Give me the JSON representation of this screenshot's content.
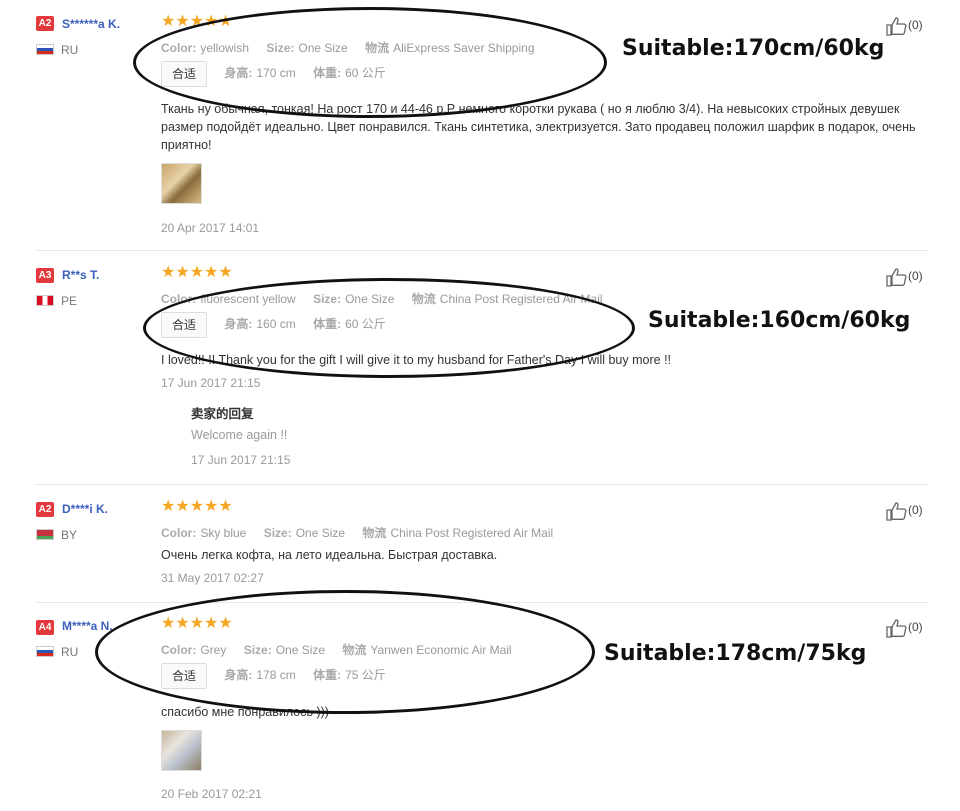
{
  "reviews": [
    {
      "badge": "A2",
      "user": "S******a K.",
      "country": "RU",
      "stars": "★★★★★",
      "color_label": "Color:",
      "color_value": "yellowish",
      "size_label": "Size:",
      "size_value": "One Size",
      "ship_label": "物流",
      "ship_value": "AliExpress Saver Shipping",
      "fit": "合适",
      "height_label": "身高:",
      "height_value": "170 cm",
      "weight_label": "体重:",
      "weight_value": "60 公斤",
      "text": "Ткань ну обычная, тонкая! На рост 170 и 44-46 р.Р немного коротки рукава ( но я люблю 3/4). На невысоких стройных девушек размер подойдёт идеально. Цвет понравился. Ткань синтетика, электризуется. Зато продавец положил шарфик в подарок, очень приятно!",
      "date": "20 Apr 2017 14:01",
      "likes": "(0)"
    },
    {
      "badge": "A3",
      "user": "R**s T.",
      "country": "PE",
      "stars": "★★★★★",
      "color_label": "Color:",
      "color_value": "fluorescent yellow",
      "size_label": "Size:",
      "size_value": "One Size",
      "ship_label": "物流",
      "ship_value": "China Post Registered Air Mail",
      "fit": "合适",
      "height_label": "身高:",
      "height_value": "160 cm",
      "weight_label": "体重:",
      "weight_value": "60 公斤",
      "text": "I loved!! !! Thank you for the gift I will give it to my husband for Father's Day I will buy more !!",
      "date": "17 Jun 2017 21:15",
      "reply_title": "卖家的回复",
      "reply_text": "Welcome again !!",
      "reply_date": "17 Jun 2017 21:15",
      "likes": "(0)"
    },
    {
      "badge": "A2",
      "user": "D****i K.",
      "country": "BY",
      "stars": "★★★★★",
      "color_label": "Color:",
      "color_value": "Sky blue",
      "size_label": "Size:",
      "size_value": "One Size",
      "ship_label": "物流",
      "ship_value": "China Post Registered Air Mail",
      "text": "Очень легка кофта, на лето идеальна. Быстрая доставка.",
      "date": "31 May 2017 02:27",
      "likes": "(0)"
    },
    {
      "badge": "A4",
      "user": "M****a N.",
      "country": "RU",
      "stars": "★★★★★",
      "color_label": "Color:",
      "color_value": "Grey",
      "size_label": "Size:",
      "size_value": "One Size",
      "ship_label": "物流",
      "ship_value": "Yanwen Economic Air Mail",
      "fit": "合适",
      "height_label": "身高:",
      "height_value": "178 cm",
      "weight_label": "体重:",
      "weight_value": "75 公斤",
      "text": "спасибо мне понравилось )))",
      "date": "20 Feb 2017 02:21",
      "likes": "(0)"
    }
  ],
  "annotations": [
    "Suitable:170cm/60kg",
    "Suitable:160cm/60kg",
    "Suitable:178cm/75kg"
  ],
  "colors": {
    "badge": "#e4393c",
    "star": "#f5a623",
    "username": "#3a5fbd"
  }
}
